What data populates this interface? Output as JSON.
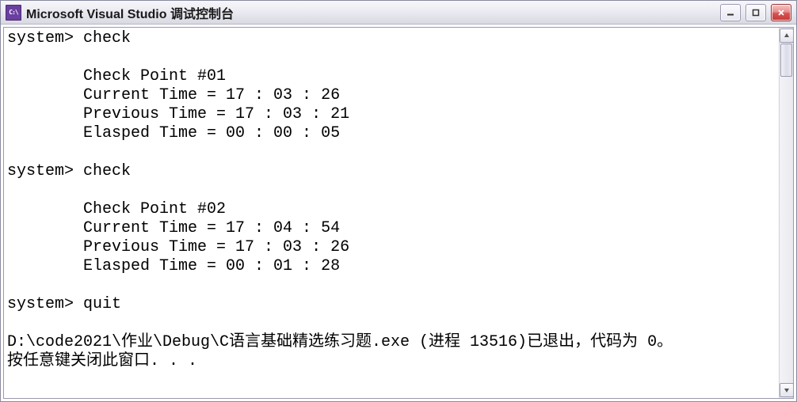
{
  "window": {
    "title": "Microsoft Visual Studio 调试控制台",
    "icon_label": "C:\\"
  },
  "terminal": {
    "sessions": [
      {
        "prompt": "system>",
        "command": "check",
        "block": [
          "Check Point #01",
          "Current Time = 17 : 03 : 26",
          "Previous Time = 17 : 03 : 21",
          "Elasped Time = 00 : 00 : 05"
        ]
      },
      {
        "prompt": "system>",
        "command": "check",
        "block": [
          "Check Point #02",
          "Current Time = 17 : 04 : 54",
          "Previous Time = 17 : 03 : 26",
          "Elasped Time = 00 : 01 : 28"
        ]
      },
      {
        "prompt": "system>",
        "command": "quit",
        "block": []
      }
    ],
    "exit_line": "D:\\code2021\\作业\\Debug\\C语言基础精选练习题.exe (进程 13516)已退出，代码为 0。",
    "press_key_line": "按任意键关闭此窗口. . ."
  }
}
